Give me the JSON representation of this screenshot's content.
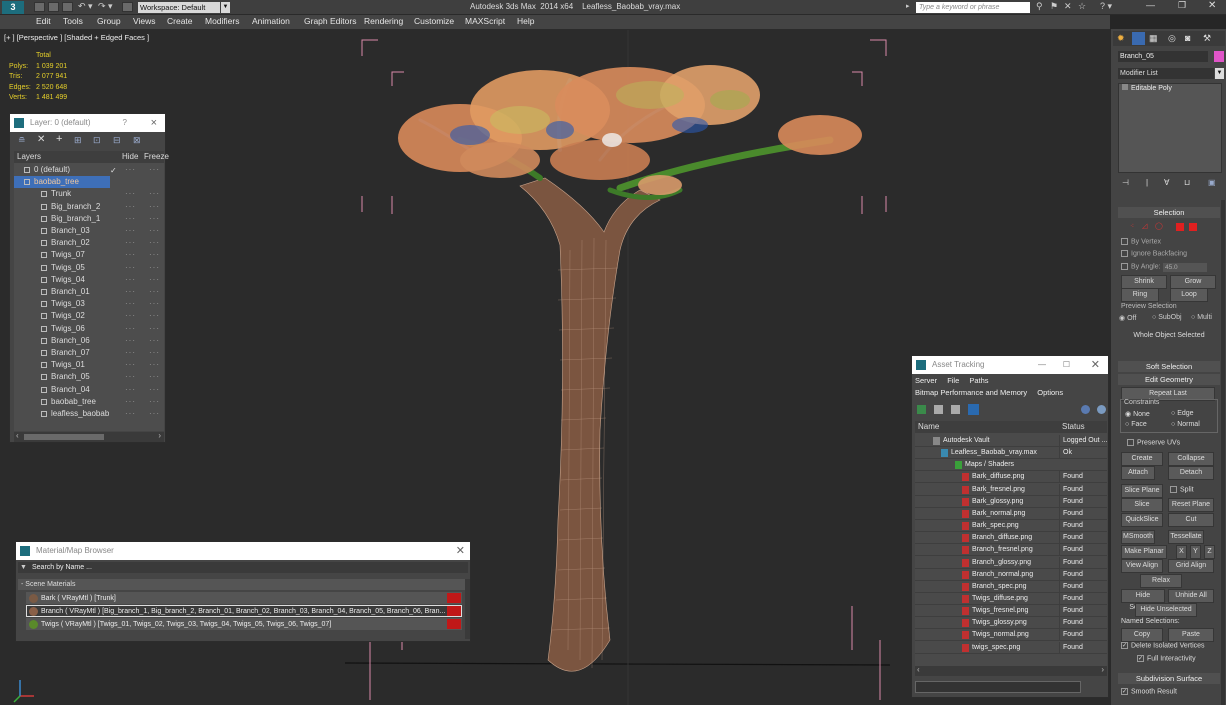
{
  "app": {
    "title": "Autodesk 3ds Max  2014 x64    Leafless_Baobab_vray.max",
    "workspace": "Workspace: Default",
    "search_placeholder": "Type a keyword or phrase"
  },
  "menu": [
    "Edit",
    "Tools",
    "Group",
    "Views",
    "Create",
    "Modifiers",
    "Animation",
    "Graph Editors",
    "Rendering",
    "Customize",
    "MAXScript",
    "Help"
  ],
  "viewport": {
    "label": "[+ ] [Perspective ] [Shaded + Edged Faces ]",
    "stats": {
      "header": "Total",
      "rows": [
        [
          "Polys:",
          "1 039 201"
        ],
        [
          "Tris:",
          "2 077 941"
        ],
        [
          "Edges:",
          "2 520 648"
        ],
        [
          "Verts:",
          "1 481 499"
        ]
      ]
    }
  },
  "layers": {
    "title": "Layer: 0 (default)",
    "help": "?",
    "close": "×",
    "columns": [
      "Layers",
      "Hide",
      "Freeze"
    ],
    "items": [
      {
        "name": "0 (default)",
        "level": 0,
        "selected": false,
        "check": "✓"
      },
      {
        "name": "baobab_tree",
        "level": 0,
        "selected": true,
        "check": ""
      },
      {
        "name": "Trunk",
        "level": 1
      },
      {
        "name": "Big_branch_2",
        "level": 1
      },
      {
        "name": "Big_branch_1",
        "level": 1
      },
      {
        "name": "Branch_03",
        "level": 1
      },
      {
        "name": "Branch_02",
        "level": 1
      },
      {
        "name": "Twigs_07",
        "level": 1
      },
      {
        "name": "Twigs_05",
        "level": 1
      },
      {
        "name": "Twigs_04",
        "level": 1
      },
      {
        "name": "Branch_01",
        "level": 1
      },
      {
        "name": "Twigs_03",
        "level": 1
      },
      {
        "name": "Twigs_02",
        "level": 1
      },
      {
        "name": "Twigs_06",
        "level": 1
      },
      {
        "name": "Branch_06",
        "level": 1
      },
      {
        "name": "Branch_07",
        "level": 1
      },
      {
        "name": "Twigs_01",
        "level": 1
      },
      {
        "name": "Branch_05",
        "level": 1
      },
      {
        "name": "Branch_04",
        "level": 1
      },
      {
        "name": "baobab_tree",
        "level": 1
      },
      {
        "name": "leafless_baobab",
        "level": 1
      }
    ]
  },
  "material_browser": {
    "title": "Material/Map Browser",
    "search_placeholder": "Search by Name ...",
    "section": "- Scene Materials",
    "items": [
      {
        "text": "Bark  ( VRayMtl )  [Trunk]",
        "swatch": "#7a5a44"
      },
      {
        "text": "Branch  ( VRayMtl )  [Big_branch_1, Big_branch_2, Branch_01, Branch_02, Branch_03, Branch_04, Branch_05, Branch_06, Bran...",
        "swatch": "#8a6048",
        "selected": true
      },
      {
        "text": "Twigs  ( VRayMtl )  [Twigs_01, Twigs_02, Twigs_03, Twigs_04, Twigs_05, Twigs_06, Twigs_07]",
        "swatch": "#5a8a2a"
      }
    ]
  },
  "asset_tracking": {
    "title": "Asset Tracking",
    "menu1": [
      "Server",
      "File",
      "Paths"
    ],
    "menu2": [
      "Bitmap Performance and Memory",
      "Options"
    ],
    "columns": [
      "Name",
      "Status"
    ],
    "rows": [
      {
        "name": "Autodesk Vault",
        "status": "Logged Out ...",
        "level": 0
      },
      {
        "name": "Leafless_Baobab_vray.max",
        "status": "Ok",
        "level": 1
      },
      {
        "name": "Maps / Shaders",
        "status": "",
        "level": 2
      },
      {
        "name": "Bark_diffuse.png",
        "status": "Found",
        "level": 3
      },
      {
        "name": "Bark_fresnel.png",
        "status": "Found",
        "level": 3
      },
      {
        "name": "Bark_glossy.png",
        "status": "Found",
        "level": 3
      },
      {
        "name": "Bark_normal.png",
        "status": "Found",
        "level": 3
      },
      {
        "name": "Bark_spec.png",
        "status": "Found",
        "level": 3
      },
      {
        "name": "Branch_diffuse.png",
        "status": "Found",
        "level": 3
      },
      {
        "name": "Branch_fresnel.png",
        "status": "Found",
        "level": 3
      },
      {
        "name": "Branch_glossy.png",
        "status": "Found",
        "level": 3
      },
      {
        "name": "Branch_normal.png",
        "status": "Found",
        "level": 3
      },
      {
        "name": "Branch_spec.png",
        "status": "Found",
        "level": 3
      },
      {
        "name": "Twigs_diffuse.png",
        "status": "Found",
        "level": 3
      },
      {
        "name": "Twigs_fresnel.png",
        "status": "Found",
        "level": 3
      },
      {
        "name": "Twigs_glossy.png",
        "status": "Found",
        "level": 3
      },
      {
        "name": "Twigs_normal.png",
        "status": "Found",
        "level": 3
      },
      {
        "name": "twigs_spec.png",
        "status": "Found",
        "level": 3
      }
    ]
  },
  "command_panel": {
    "object_name": "Branch_05",
    "modifier_list": "Modifier List",
    "stack_item": "Editable Poly",
    "selection": {
      "title": "Selection",
      "by_vertex": "By Vertex",
      "ignore_backfacing": "Ignore Backfacing",
      "by_angle": "By Angle:",
      "angle_value": "45.0",
      "shrink": "Shrink",
      "grow": "Grow",
      "ring": "Ring",
      "loop": "Loop",
      "preview_title": "Preview Selection",
      "preview_opts": [
        "Off",
        "SubObj",
        "Multi"
      ],
      "whole_object": "Whole Object Selected"
    },
    "soft_selection": "Soft Selection",
    "edit_geometry": {
      "title": "Edit Geometry",
      "repeat_last": "Repeat Last",
      "constraints": "Constraints",
      "opts": [
        "None",
        "Edge",
        "Face",
        "Normal"
      ],
      "preserve_uvs": "Preserve UVs",
      "create": "Create",
      "collapse": "Collapse",
      "attach": "Attach",
      "detach": "Detach",
      "slice_plane": "Slice Plane",
      "split": "Split",
      "slice": "Slice",
      "reset_plane": "Reset Plane",
      "quickslice": "QuickSlice",
      "cut": "Cut",
      "msmooth": "MSmooth",
      "tessellate": "Tessellate",
      "make_planar": "Make Planar",
      "x": "X",
      "y": "Y",
      "z": "Z",
      "view_align": "View Align",
      "grid_align": "Grid Align",
      "relax": "Relax",
      "hide_selected": "Hide Selected",
      "unhide_all": "Unhide All",
      "hide_unselected": "Hide Unselected",
      "named_selections": "Named Selections:",
      "copy": "Copy",
      "paste": "Paste",
      "delete_isolated": "Delete Isolated Vertices",
      "full_interactivity": "Full Interactivity"
    },
    "subdivision": {
      "title": "Subdivision Surface",
      "smooth_result": "Smooth Result"
    }
  }
}
